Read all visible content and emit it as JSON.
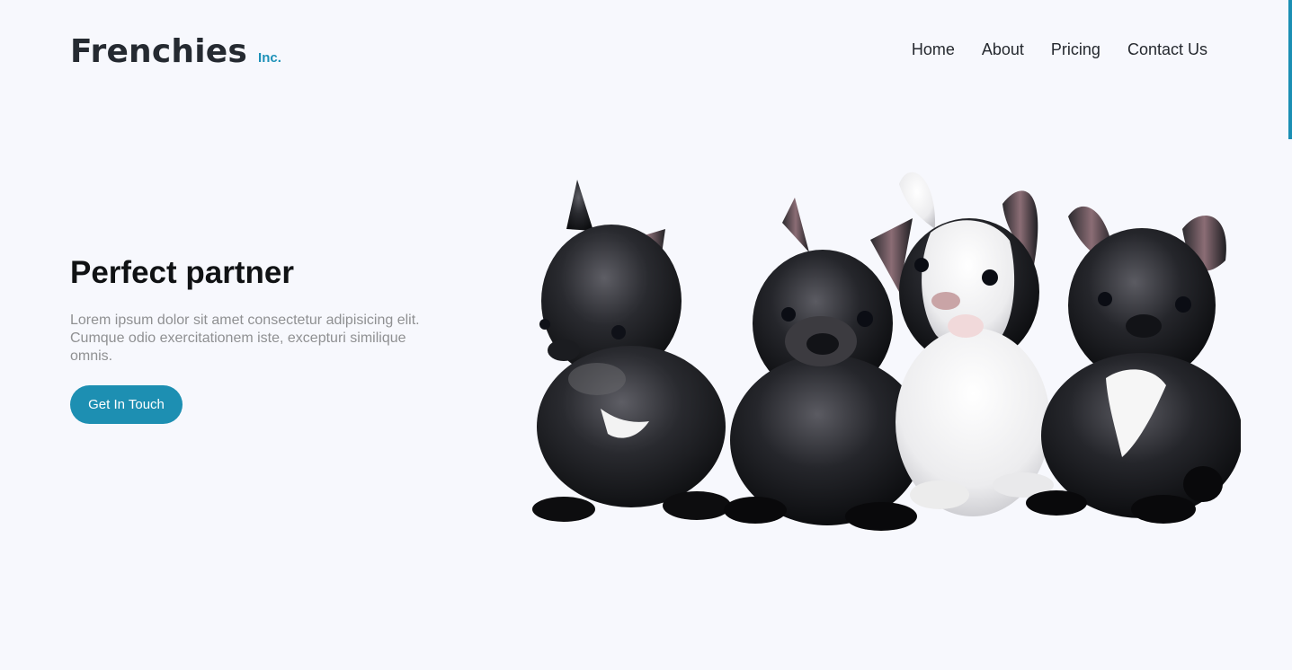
{
  "brand": {
    "name": "Frenchies",
    "suffix": "Inc."
  },
  "nav": {
    "items": [
      "Home",
      "About",
      "Pricing",
      "Contact Us"
    ]
  },
  "hero": {
    "title": "Perfect partner",
    "description": "Lorem ipsum dolor sit amet consectetur adipisicing elit. Cumque odio exercitationem iste, excepturi similique omnis.",
    "cta_label": "Get In Touch"
  },
  "theme": {
    "background": "#f7f8fd",
    "accent": "#1d8fb2",
    "text": "#252a31"
  },
  "image": {
    "subject": "four-french-bulldog-puppies"
  }
}
